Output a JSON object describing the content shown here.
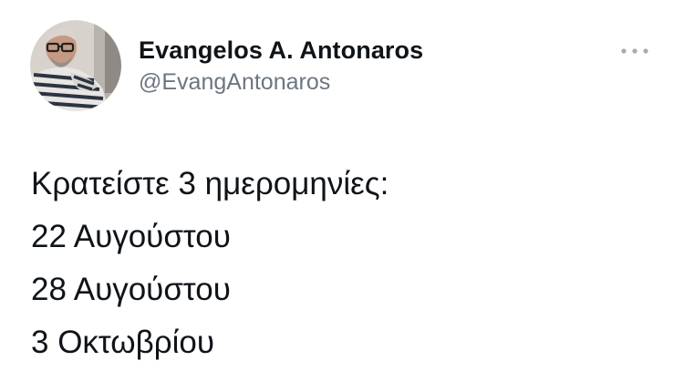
{
  "tweet": {
    "author": {
      "display_name": "Evangelos A. Antonaros",
      "handle": "@EvangAntonaros",
      "avatar_icon": "profile-photo"
    },
    "more_icon": "more-horizontal-icon",
    "text_lines": [
      "Κρατείστε 3 ημερομηνίες:",
      "22 Αυγούστου",
      "28 Αυγούστου",
      "3 Οκτωβρίου"
    ]
  },
  "colors": {
    "text_primary": "#0f1419",
    "text_secondary": "#6b7680",
    "icon_muted": "#a3abb3",
    "background": "#ffffff"
  }
}
